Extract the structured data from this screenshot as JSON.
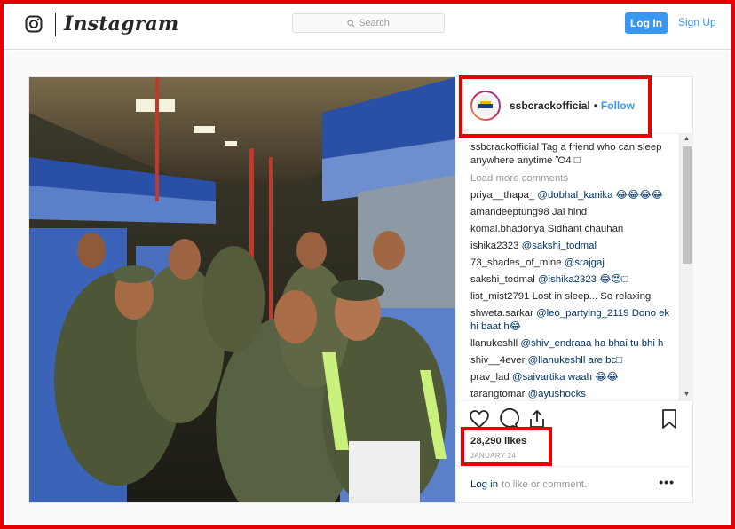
{
  "header": {
    "brand": "Instagram",
    "search_placeholder": "Search",
    "login_label": "Log In",
    "signup_label": "Sign Up"
  },
  "post": {
    "username": "ssbcrackofficial",
    "separator": "•",
    "follow_label": "Follow",
    "caption": "Tag a friend who can sleep anywhere anytime Ὂ4 □",
    "load_more_label": "Load more comments",
    "comments": [
      {
        "user": "priya__thapa_",
        "text": "@dobhal_kanika 😂😂😂😂"
      },
      {
        "user": "amandeeptung98",
        "text": "Jai hind"
      },
      {
        "user": "komal.bhadoriya",
        "text": "Sidhant chauhan"
      },
      {
        "user": "ishika2323",
        "text": "@sakshi_todmal"
      },
      {
        "user": "73_shades_of_mine",
        "text": "@srajgaj"
      },
      {
        "user": "sakshi_todmal",
        "text": "@ishika2323 😂😍□"
      },
      {
        "user": "list_mist2791",
        "text": "Lost in sleep... So relaxing"
      },
      {
        "user": "shweta.sarkar",
        "text": "@leo_partying_2119 Dono ek hi baat h😂"
      },
      {
        "user": "llanukeshll",
        "text": "@shiv_endraaa ha bhai tu bhi h"
      },
      {
        "user": "shiv__4ever",
        "text": "@llanukeshll are bc□"
      },
      {
        "user": "prav_lad",
        "text": "@saivartika waah 😂😂"
      },
      {
        "user": "tarangtomar",
        "text": "@ayushocks"
      }
    ],
    "likes": "28,290 likes",
    "date": "JANUARY 24",
    "login_link": "Log in",
    "login_suffix": "to like or comment.",
    "more": "•••"
  },
  "icons": {
    "brand_glyph": "instagram-camera-icon",
    "search": "search-icon",
    "like": "heart-icon",
    "comment": "comment-icon",
    "share": "share-icon",
    "save": "bookmark-icon",
    "more": "more-options-icon"
  },
  "colors": {
    "accent": "#3897f0",
    "annotation": "#e60000",
    "mention": "#003569"
  }
}
